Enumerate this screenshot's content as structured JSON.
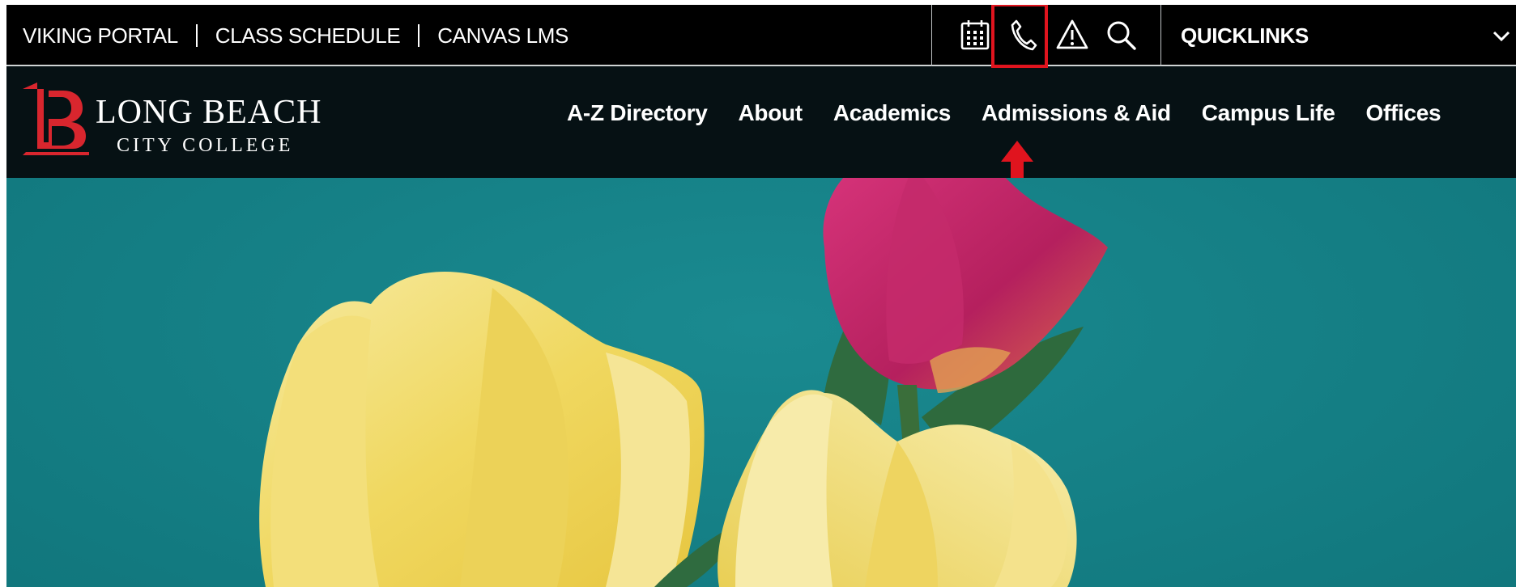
{
  "utility_bar": {
    "links": [
      "VIKING PORTAL",
      "CLASS SCHEDULE",
      "CANVAS LMS"
    ],
    "icons": [
      "calendar-icon",
      "phone-icon",
      "alert-icon",
      "search-icon"
    ],
    "quicklinks_label": "QUICKLINKS"
  },
  "logo": {
    "name": "LONG BEACH",
    "subtitle": "CITY COLLEGE"
  },
  "nav": {
    "items": [
      "A-Z Directory",
      "About",
      "Academics",
      "Admissions & Aid",
      "Campus Life",
      "Offices"
    ]
  },
  "annotation": {
    "highlight": "phone-icon",
    "color": "#e0141e"
  },
  "colors": {
    "utility_bg": "#000000",
    "nav_bg": "#061114",
    "hero_bg": "#147d84",
    "logo_red": "#d8262e"
  }
}
